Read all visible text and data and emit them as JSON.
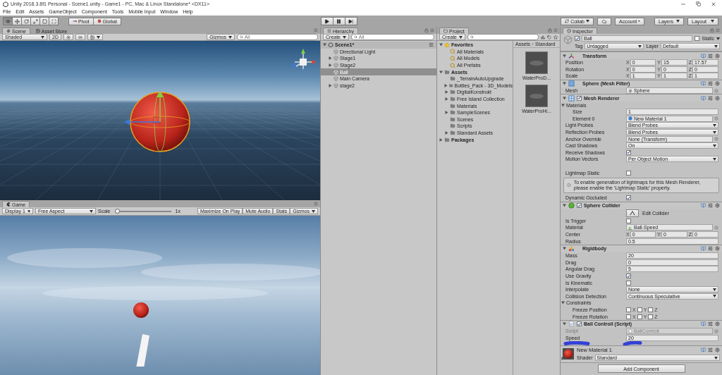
{
  "window": {
    "title": "Unity 2018.3.8f1 Personal - Scene1.unity - Game1 - PC, Mac & Linux Standalone* <DX11>"
  },
  "menu": [
    "File",
    "Edit",
    "Assets",
    "GameObject",
    "Component",
    "Tools",
    "Mobile Input",
    "Window",
    "Help"
  ],
  "toolbar": {
    "tools": [
      {
        "selected": true
      },
      {
        "selected": false
      },
      {
        "selected": false
      },
      {
        "selected": false
      },
      {
        "selected": false
      },
      {
        "selected": false
      }
    ],
    "pivot": "Pivot",
    "space": "Global",
    "right_buttons": [
      {
        "kind": "collab",
        "label": "Collab"
      },
      {
        "kind": "cloud"
      },
      {
        "kind": "dropdown",
        "label": "Account"
      },
      {
        "kind": "dropdown",
        "label": "Layers"
      },
      {
        "kind": "dropdown",
        "label": "Layout"
      }
    ]
  },
  "scene_panel": {
    "tabs": [
      {
        "label": "Scene",
        "selected": true
      },
      {
        "label": "Asset Store",
        "selected": false
      }
    ],
    "shading": "Shaded",
    "mode_2d": "2D",
    "gizmos": "Gizmos",
    "search_placeholder": "All"
  },
  "game_panel": {
    "tab": "Game",
    "display": "Display 1",
    "aspect": "Free Aspect",
    "scale_label": "Scale",
    "scale": {
      "level": 0.04
    },
    "scale_reading": "1x",
    "buttons": [
      {
        "label": "Maximize On Play",
        "dropdown": false
      },
      {
        "label": "Mute Audio",
        "dropdown": false
      },
      {
        "label": "Stats",
        "dropdown": false
      },
      {
        "label": "Gizmos",
        "dropdown": true
      }
    ]
  },
  "hierarchy": {
    "tab": "Hierarchy",
    "create": "Create",
    "search_placeholder": "All",
    "tree": [
      {
        "label": "Scene1*",
        "kind": "scene",
        "expanded": true,
        "selected": false,
        "children": [
          {
            "label": "Directional Light",
            "kind": "object",
            "selected": false
          },
          {
            "label": "Stage1",
            "kind": "object",
            "expanded": false,
            "selected": false
          },
          {
            "label": "Stage2",
            "kind": "object",
            "expanded": false,
            "selected": false
          },
          {
            "label": "Ball",
            "kind": "object",
            "selected": true
          },
          {
            "label": "Main Camera",
            "kind": "object",
            "selected": false
          },
          {
            "label": "stage2",
            "kind": "object",
            "expanded": false,
            "selected": false
          }
        ]
      }
    ]
  },
  "project": {
    "tab": "Project",
    "create": "Create",
    "tree": [
      {
        "label": "Favorites",
        "kind": "favorites",
        "expanded": true,
        "selected": false,
        "children": [
          {
            "label": "All Materials",
            "kind": "search",
            "selected": false
          },
          {
            "label": "All Models",
            "kind": "search",
            "selected": false
          },
          {
            "label": "All Prefabs",
            "kind": "search",
            "selected": false
          }
        ]
      },
      {
        "label": "Assets",
        "kind": "folder",
        "expanded": true,
        "selected": false,
        "children": [
          {
            "label": "_TerrainAutoUpgrade",
            "kind": "folder",
            "selected": false
          },
          {
            "label": "Bottles_Pack - 3D_Models",
            "kind": "folder",
            "expanded": false,
            "selected": false
          },
          {
            "label": "DigitalKonstrukt",
            "kind": "folder",
            "expanded": false,
            "selected": false
          },
          {
            "label": "Free Island Collection",
            "kind": "folder",
            "expanded": false,
            "selected": false
          },
          {
            "label": "Materials",
            "kind": "folder",
            "selected": false
          },
          {
            "label": "SampleScenes",
            "kind": "folder",
            "expanded": false,
            "selected": false
          },
          {
            "label": "Scenes",
            "kind": "folder",
            "selected": false
          },
          {
            "label": "Scripts",
            "kind": "folder",
            "selected": false
          },
          {
            "label": "Standard Assets",
            "kind": "folder",
            "expanded": false,
            "selected": false
          }
        ]
      },
      {
        "label": "Packages",
        "kind": "folder",
        "expanded": false,
        "selected": false
      }
    ],
    "breadcrumb": [
      "Assets",
      "Standard"
    ],
    "files": [
      "WaterProD...",
      "WaterProHi..."
    ]
  },
  "inspector": {
    "tab": "Inspector",
    "object": {
      "name": "Ball",
      "active": true,
      "static_label": "Static",
      "static": false,
      "tag_label": "Tag",
      "tag": "Untagged",
      "layer_label": "Layer",
      "layer": "Default"
    },
    "components": [
      {
        "kind": "transform",
        "title": "Transform",
        "expanded": true,
        "rows": [
          {
            "kind": "vector",
            "label": "Position",
            "axes": [
              {
                "axis": "X",
                "value": "0"
              },
              {
                "axis": "Y",
                "value": "15"
              },
              {
                "axis": "Z",
                "value": "17.57"
              }
            ]
          },
          {
            "kind": "vector",
            "label": "Rotation",
            "axes": [
              {
                "axis": "X",
                "value": "0"
              },
              {
                "axis": "Y",
                "value": "0"
              },
              {
                "axis": "Z",
                "value": "0"
              }
            ]
          },
          {
            "kind": "vector",
            "label": "Scale",
            "axes": [
              {
                "axis": "X",
                "value": "1"
              },
              {
                "axis": "Y",
                "value": "1"
              },
              {
                "axis": "Z",
                "value": "1"
              }
            ]
          }
        ]
      },
      {
        "kind": "mesh_filter",
        "title": "Sphere (Mesh Filter)",
        "expanded": true,
        "rows": [
          {
            "kind": "mesh_ref",
            "label": "Mesh",
            "value": "Sphere"
          }
        ]
      },
      {
        "kind": "mesh_renderer",
        "title": "Mesh Renderer",
        "enabled": true,
        "expanded": true,
        "rows": [
          {
            "kind": "section",
            "label": "Materials",
            "expanded": true,
            "children": [
              {
                "kind": "field",
                "label": "Size",
                "value": "1"
              },
              {
                "kind": "material_ref",
                "label": "Element 0",
                "value": "New Material 1"
              }
            ]
          },
          {
            "kind": "dropdown",
            "label": "Light Probes",
            "value": "Blend Probes"
          },
          {
            "kind": "dropdown",
            "label": "Reflection Probes",
            "value": "Blend Probes"
          },
          {
            "kind": "object",
            "label": "Anchor Override",
            "value": "None (Transform)"
          },
          {
            "kind": "dropdown",
            "label": "Cast Shadows",
            "value": "On"
          },
          {
            "kind": "checkbox",
            "label": "Receive Shadows",
            "checked": true
          },
          {
            "kind": "dropdown",
            "label": "Motion Vectors",
            "value": "Per Object Motion"
          },
          {
            "kind": "spacer"
          },
          {
            "kind": "checkbox",
            "label": "Lightmap Static",
            "checked": false
          },
          {
            "kind": "help",
            "text": "To enable generation of lightmaps for this Mesh Renderer, please enable the 'Lightmap Static' property."
          },
          {
            "kind": "checkbox",
            "label": "Dynamic Occluded",
            "checked": true
          }
        ]
      },
      {
        "kind": "collider",
        "title": "Sphere Collider",
        "enabled": true,
        "expanded": true,
        "rows": [
          {
            "kind": "button",
            "label": "Edit Collider"
          },
          {
            "kind": "checkbox",
            "label": "Is Trigger",
            "checked": false
          },
          {
            "kind": "physic_material_ref",
            "label": "Material",
            "value": "Ball-Speed"
          },
          {
            "kind": "vector",
            "label": "Center",
            "axes": [
              {
                "axis": "X",
                "value": "0"
              },
              {
                "axis": "Y",
                "value": "0"
              },
              {
                "axis": "Z",
                "value": "0"
              }
            ]
          },
          {
            "kind": "field",
            "label": "Radius",
            "value": "0.5"
          }
        ]
      },
      {
        "kind": "rigidbody",
        "title": "Rigidbody",
        "expanded": true,
        "rows": [
          {
            "kind": "field",
            "label": "Mass",
            "value": "20"
          },
          {
            "kind": "field",
            "label": "Drag",
            "value": "0"
          },
          {
            "kind": "field",
            "label": "Angular Drag",
            "value": "5"
          },
          {
            "kind": "checkbox",
            "label": "Use Gravity",
            "checked": true
          },
          {
            "kind": "checkbox",
            "label": "Is Kinematic",
            "checked": false
          },
          {
            "kind": "dropdown",
            "label": "Interpolate",
            "value": "None"
          },
          {
            "kind": "dropdown",
            "label": "Collision Detection",
            "value": "Continuous Speculative"
          },
          {
            "kind": "section",
            "label": "Constraints",
            "expanded": true,
            "children": [
              {
                "kind": "flags",
                "label": "Freeze Position",
                "flags": [
                  {
                    "axis": "X",
                    "checked": false
                  },
                  {
                    "axis": "Y",
                    "checked": false
                  },
                  {
                    "axis": "Z",
                    "checked": false
                  }
                ]
              },
              {
                "kind": "flags",
                "label": "Freeze Rotation",
                "flags": [
                  {
                    "axis": "X",
                    "checked": false
                  },
                  {
                    "axis": "Y",
                    "checked": false
                  },
                  {
                    "axis": "Z",
                    "checked": false
                  }
                ]
              }
            ]
          }
        ]
      },
      {
        "kind": "script",
        "title": "Ball Controll (Script)",
        "enabled": true,
        "expanded": true,
        "rows": [
          {
            "kind": "script_ref",
            "label": "Script",
            "value": "BallControll"
          },
          {
            "kind": "field",
            "label": "Speed",
            "value": "20"
          }
        ]
      }
    ],
    "material": {
      "name": "New Material 1",
      "shader_label": "Shader",
      "shader": "Standard",
      "expanded": false
    },
    "add_component": "Add Component"
  }
}
